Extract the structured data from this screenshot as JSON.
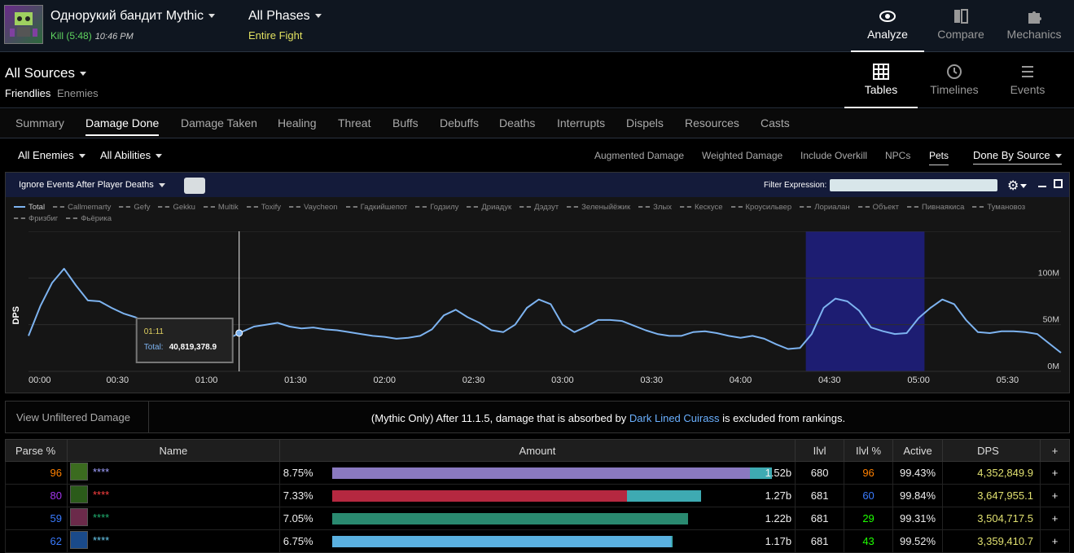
{
  "header": {
    "fight_title": "Однорукий бандит Mythic",
    "kill_label": "Kill (5:48)",
    "kill_time": "10:46 PM",
    "phase_title": "All Phases",
    "phase_sub": "Entire Fight",
    "nav": [
      {
        "label": "Analyze",
        "icon": "eye-icon"
      },
      {
        "label": "Compare",
        "icon": "compare-icon"
      },
      {
        "label": "Mechanics",
        "icon": "puzzle-icon"
      }
    ]
  },
  "sources": {
    "title": "All Sources",
    "friendlies": "Friendlies",
    "enemies": "Enemies",
    "views": [
      {
        "label": "Tables",
        "icon": "table-icon"
      },
      {
        "label": "Timelines",
        "icon": "clock-icon"
      },
      {
        "label": "Events",
        "icon": "list-icon"
      }
    ]
  },
  "tabs": [
    "Summary",
    "Damage Done",
    "Damage Taken",
    "Healing",
    "Threat",
    "Buffs",
    "Debuffs",
    "Deaths",
    "Interrupts",
    "Dispels",
    "Resources",
    "Casts"
  ],
  "filters": {
    "enemies": "All Enemies",
    "abilities": "All Abilities",
    "options": [
      "Augmented Damage",
      "Weighted Damage",
      "Include Overkill",
      "NPCs",
      "Pets"
    ],
    "done_by": "Done By Source"
  },
  "graph": {
    "ignore_label": "Ignore Events After Player Deaths",
    "filter_label": "Filter Expression:",
    "legend": [
      "Total",
      "Callmemarty",
      "Gefy",
      "Gekku",
      "Multik",
      "Toxify",
      "Vaycheon",
      "Гадкийшепот",
      "Годзилу",
      "Дриадук",
      "Дэдзут",
      "Зеленыйёжик",
      "Злых",
      "Кескусе",
      "Кроусильвер",
      "Лориалан",
      "Объект",
      "Пивнаякиса",
      "Тумановоз",
      "Фризбиг",
      "Фьёрика"
    ],
    "tooltip_time": "01:11",
    "tooltip_label": "Total:",
    "tooltip_value": "40,819,378.9",
    "ylabel": "DPS"
  },
  "chart_data": {
    "type": "line",
    "ylabel": "DPS",
    "x_ticks": [
      "00:00",
      "00:30",
      "01:00",
      "01:30",
      "02:00",
      "02:30",
      "03:00",
      "03:30",
      "04:00",
      "04:30",
      "05:00",
      "05:30"
    ],
    "y_ticks": [
      "0M",
      "50M",
      "100M"
    ],
    "ylim": [
      0,
      150
    ],
    "xlim": [
      0,
      348
    ],
    "highlight": [
      262,
      302
    ],
    "cursor_x": 71,
    "series": [
      {
        "name": "Total",
        "x": [
          0,
          4,
          8,
          12,
          16,
          20,
          24,
          28,
          32,
          36,
          40,
          44,
          48,
          52,
          56,
          60,
          64,
          68,
          71,
          76,
          80,
          84,
          88,
          92,
          96,
          100,
          104,
          108,
          112,
          116,
          120,
          124,
          128,
          132,
          136,
          140,
          144,
          148,
          152,
          156,
          160,
          164,
          168,
          172,
          176,
          180,
          184,
          188,
          192,
          196,
          200,
          204,
          208,
          212,
          216,
          220,
          224,
          228,
          232,
          236,
          240,
          244,
          248,
          252,
          256,
          260,
          264,
          268,
          272,
          276,
          280,
          284,
          288,
          292,
          296,
          300,
          304,
          308,
          312,
          316,
          320,
          324,
          328,
          332,
          336,
          340,
          344,
          348
        ],
        "values": [
          38,
          70,
          95,
          110,
          92,
          76,
          75,
          68,
          62,
          58,
          52,
          42,
          36,
          34,
          33,
          35,
          34,
          36,
          41,
          48,
          50,
          52,
          48,
          46,
          47,
          45,
          44,
          42,
          40,
          38,
          37,
          35,
          36,
          38,
          45,
          60,
          66,
          58,
          52,
          44,
          42,
          50,
          68,
          77,
          72,
          50,
          42,
          48,
          55,
          55,
          54,
          49,
          44,
          40,
          38,
          38,
          42,
          43,
          41,
          38,
          36,
          38,
          35,
          29,
          24,
          25,
          40,
          68,
          78,
          75,
          65,
          47,
          43,
          40,
          41,
          57,
          68,
          77,
          72,
          55,
          42,
          41,
          43,
          43,
          42,
          40,
          30,
          20
        ]
      }
    ]
  },
  "notice": {
    "left": "View Unfiltered Damage",
    "prefix": "(Mythic Only) After 11.1.5, damage that is absorbed by ",
    "link": "Dark Lined Cuirass",
    "suffix": " is excluded from rankings."
  },
  "table": {
    "headers": [
      "Parse %",
      "Name",
      "Amount",
      "Ilvl",
      "Ilvl %",
      "Active",
      "DPS",
      "+"
    ],
    "rows": [
      {
        "parse": "96",
        "parse_color": "#ff8000",
        "name": "****",
        "name_color": "#a0a0ff",
        "pct": "8.75%",
        "amount": "1.52b",
        "bar_main": 0.95,
        "bar_pet": 0.05,
        "bar_color": "#8a79c0",
        "avatar": "#3b6b1f",
        "ilvl": "680",
        "ilvlp": "96",
        "ilvlp_color": "#ff8000",
        "active": "99.43%",
        "dps": "4,352,849.9",
        "plus": "+"
      },
      {
        "parse": "80",
        "parse_color": "#a335ee",
        "name": "****",
        "name_color": "#ff4040",
        "pct": "7.33%",
        "amount": "1.27b",
        "bar_main": 0.67,
        "bar_pet": 0.17,
        "bar_color": "#b52840",
        "avatar": "#2b5b1a",
        "ilvl": "681",
        "ilvlp": "60",
        "ilvlp_color": "#3a7bff",
        "active": "99.84%",
        "dps": "3,647,955.1",
        "plus": "+"
      },
      {
        "parse": "59",
        "parse_color": "#3a7bff",
        "name": "****",
        "name_color": "#20b070",
        "pct": "7.05%",
        "amount": "1.22b",
        "bar_main": 0.81,
        "bar_pet": 0.0,
        "bar_color": "#2a8a70",
        "avatar": "#6b2a4a",
        "ilvl": "681",
        "ilvlp": "29",
        "ilvlp_color": "#1eff00",
        "active": "99.31%",
        "dps": "3,504,717.5",
        "plus": "+"
      },
      {
        "parse": "62",
        "parse_color": "#3a7bff",
        "name": "****",
        "name_color": "#69ccf0",
        "pct": "6.75%",
        "amount": "1.17b",
        "bar_main": 0.77,
        "bar_pet": 0.005,
        "bar_color": "#5ab0e0",
        "avatar": "#1a4a8a",
        "ilvl": "681",
        "ilvlp": "43",
        "ilvlp_color": "#1eff00",
        "active": "99.52%",
        "dps": "3,359,410.7",
        "plus": "+"
      }
    ]
  }
}
